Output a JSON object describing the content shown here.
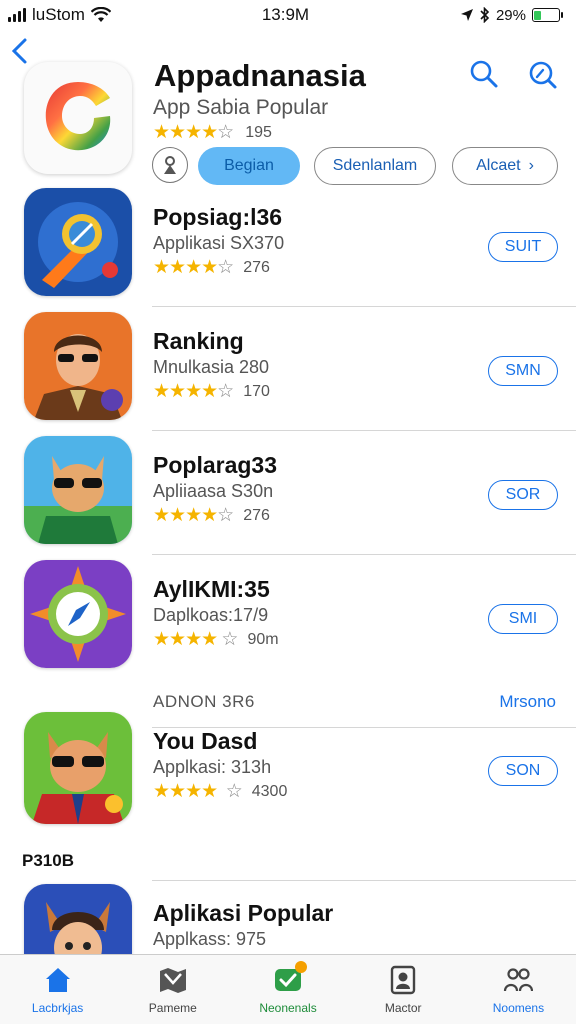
{
  "status_bar": {
    "carrier": "luStom",
    "time": "13:9M",
    "battery": "29%",
    "battery_level": 0.29
  },
  "hero": {
    "title": "Appadnanasia",
    "subtitle": "App Sabia Popular",
    "rating_count": "195",
    "stars": 4
  },
  "chips": {
    "active": "Begian",
    "second": "Sdenlanlam",
    "third": "Alcaet",
    "third_chevron": "›"
  },
  "apps": [
    {
      "name": "Popsiag:l36",
      "subtitle": "Applikasi SX370",
      "rating_count": "276",
      "stars": 4,
      "button": "SUIT"
    },
    {
      "name": "Ranking",
      "subtitle": "Mnulkasia 280",
      "rating_count": "170",
      "stars": 4,
      "button": "SMN"
    },
    {
      "name": "Poplarag33",
      "subtitle": "Apliiaasa S30n",
      "rating_count": "276",
      "stars": 4,
      "button": "SOR"
    },
    {
      "name": "AylIKMI:35",
      "subtitle": "Daplkoas:17/9",
      "rating_count": "90m",
      "stars": 4,
      "button": "SMI"
    },
    {
      "name": "You Dasd",
      "subtitle": "Applkasi: 313h",
      "rating_count": "4300",
      "stars": 4,
      "button": "SON"
    },
    {
      "name": "Aplikasi Popular",
      "subtitle": "Applkass: 975"
    }
  ],
  "section": {
    "header": "ADNON 3R6",
    "link": "Mrsono",
    "label": "P310B"
  },
  "tabs": [
    {
      "label": "Lacbrkjas",
      "icon": "home-icon"
    },
    {
      "label": "Pameme",
      "icon": "map-icon"
    },
    {
      "label": "Neonenals",
      "icon": "games-icon"
    },
    {
      "label": "Mactor",
      "icon": "portrait-icon"
    },
    {
      "label": "Noomens",
      "icon": "people-icon"
    }
  ],
  "colors": {
    "accent": "#1a73e8",
    "star": "#f5b400",
    "chip_active": "#62b8f5"
  }
}
